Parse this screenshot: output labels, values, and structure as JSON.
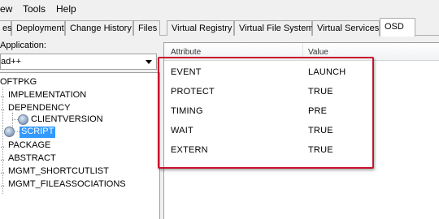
{
  "menu": [
    "ew",
    "Tools",
    "Help"
  ],
  "tabs": [
    "es",
    "Deployment",
    "Change History",
    "Files",
    "Virtual Registry",
    "Virtual File System",
    "Virtual Services",
    "OSD"
  ],
  "active_tab": "OSD",
  "application": {
    "label": "Application:",
    "value": "ad++"
  },
  "tree": {
    "root": "OFTPKG",
    "items": [
      "IMPLEMENTATION",
      "DEPENDENCY",
      "CLIENTVERSION",
      "SCRIPT",
      "PACKAGE",
      "ABSTRACT",
      "MGMT_SHORTCUTLIST",
      "MGMT_FILEASSOCIATIONS"
    ],
    "selected": "SCRIPT"
  },
  "grid": {
    "headers": {
      "attribute": "Attribute",
      "value": "Value"
    },
    "rows": [
      {
        "attribute": "EVENT",
        "value": "LAUNCH"
      },
      {
        "attribute": "PROTECT",
        "value": "TRUE"
      },
      {
        "attribute": "TIMING",
        "value": "PRE"
      },
      {
        "attribute": "WAIT",
        "value": "TRUE"
      },
      {
        "attribute": "EXTERN",
        "value": "TRUE"
      }
    ]
  },
  "colors": {
    "selection": "#3399ff",
    "annotation": "#c8102e"
  },
  "icons": [
    "chevron-down-icon",
    "gear-icon"
  ]
}
